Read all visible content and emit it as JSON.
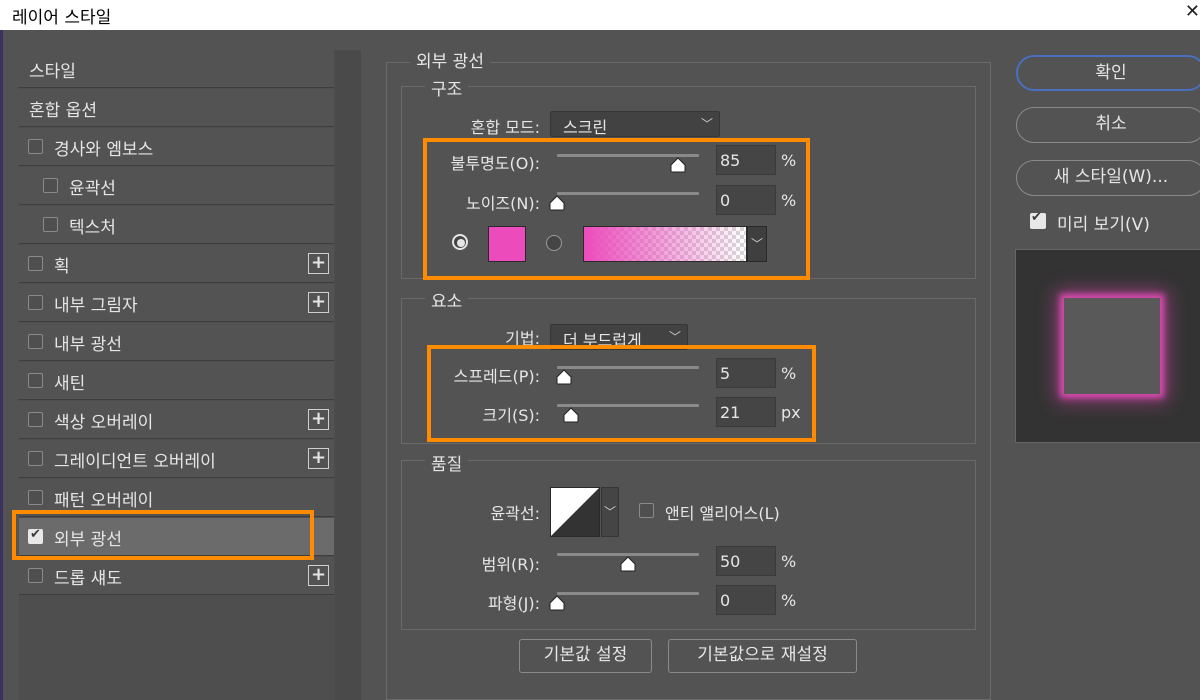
{
  "window": {
    "title": "레이어 스타일",
    "close_glyph": "✕"
  },
  "sidebar": {
    "items": [
      {
        "label": "스타일",
        "has_checkbox": false,
        "checked": false,
        "has_plus": false,
        "indent": false
      },
      {
        "label": "혼합 옵션",
        "has_checkbox": false,
        "checked": false,
        "has_plus": false,
        "indent": false
      },
      {
        "label": "경사와 엠보스",
        "has_checkbox": true,
        "checked": false,
        "has_plus": false,
        "indent": false
      },
      {
        "label": "윤곽선",
        "has_checkbox": true,
        "checked": false,
        "has_plus": false,
        "indent": true
      },
      {
        "label": "텍스처",
        "has_checkbox": true,
        "checked": false,
        "has_plus": false,
        "indent": true
      },
      {
        "label": "획",
        "has_checkbox": true,
        "checked": false,
        "has_plus": true,
        "indent": false
      },
      {
        "label": "내부 그림자",
        "has_checkbox": true,
        "checked": false,
        "has_plus": true,
        "indent": false
      },
      {
        "label": "내부 광선",
        "has_checkbox": true,
        "checked": false,
        "has_plus": false,
        "indent": false
      },
      {
        "label": "새틴",
        "has_checkbox": true,
        "checked": false,
        "has_plus": false,
        "indent": false
      },
      {
        "label": "색상 오버레이",
        "has_checkbox": true,
        "checked": false,
        "has_plus": true,
        "indent": false
      },
      {
        "label": "그레이디언트 오버레이",
        "has_checkbox": true,
        "checked": false,
        "has_plus": true,
        "indent": false
      },
      {
        "label": "패턴 오버레이",
        "has_checkbox": true,
        "checked": false,
        "has_plus": false,
        "indent": false
      },
      {
        "label": "외부 광선",
        "has_checkbox": true,
        "checked": true,
        "has_plus": false,
        "indent": false,
        "selected": true
      },
      {
        "label": "드롭 섀도",
        "has_checkbox": true,
        "checked": false,
        "has_plus": true,
        "indent": false
      }
    ],
    "plus_glyph": "+"
  },
  "panel": {
    "title": "외부 광선",
    "structure": {
      "title": "구조",
      "blend_mode_label": "혼합 모드:",
      "blend_mode_value": "스크린",
      "opacity_label": "불투명도(O):",
      "opacity_value": "85",
      "opacity_fraction": 0.85,
      "noise_label": "노이즈(N):",
      "noise_value": "0",
      "noise_fraction": 0,
      "percent": "%",
      "glow_color": "#ec4bbc"
    },
    "elements": {
      "title": "요소",
      "technique_label": "기법:",
      "technique_value": "더 부드럽게",
      "spread_label": "스프레드(P):",
      "spread_value": "5",
      "spread_fraction": 0.05,
      "size_label": "크기(S):",
      "size_value": "21",
      "size_fraction": 0.1,
      "percent": "%",
      "px": "px"
    },
    "quality": {
      "title": "품질",
      "contour_label": "윤곽선:",
      "antialias_label": "앤티 앨리어스(L)",
      "range_label": "범위(R):",
      "range_value": "50",
      "range_fraction": 0.5,
      "jitter_label": "파형(J):",
      "jitter_value": "0",
      "jitter_fraction": 0,
      "percent": "%"
    },
    "buttons": {
      "make_default": "기본값 설정",
      "reset_default": "기본값으로 재설정"
    }
  },
  "right": {
    "ok": "확인",
    "cancel": "취소",
    "new_style": "새 스타일(W)...",
    "preview_label": "미리 보기(V)",
    "preview_checked": true
  },
  "colors": {
    "highlight": "#ff8c00",
    "accent_border": "#4a6fbe"
  }
}
